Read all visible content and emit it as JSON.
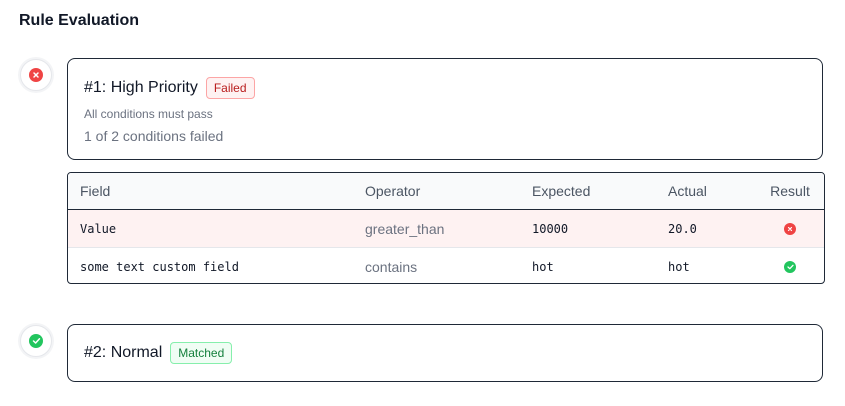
{
  "header": {
    "title": "Rule Evaluation"
  },
  "colors": {
    "fail": "#ef4444",
    "pass": "#22c55e"
  },
  "rules": [
    {
      "title": "#1: High Priority",
      "badge": "Failed",
      "status": "failed",
      "subtitle": "All conditions must pass",
      "summary": "1 of 2 conditions failed",
      "table": {
        "headers": [
          "Field",
          "Operator",
          "Expected",
          "Actual",
          "Result"
        ],
        "rows": [
          {
            "field": "Value",
            "operator": "greater_than",
            "expected": "10000",
            "actual": "20.0",
            "result": "fail",
            "result_icon": "x-circle-icon"
          },
          {
            "field": "some text custom field",
            "operator": "contains",
            "expected": "hot",
            "actual": "hot",
            "result": "pass",
            "result_icon": "check-circle-icon"
          }
        ]
      }
    },
    {
      "title": "#2: Normal",
      "badge": "Matched",
      "status": "matched"
    }
  ]
}
